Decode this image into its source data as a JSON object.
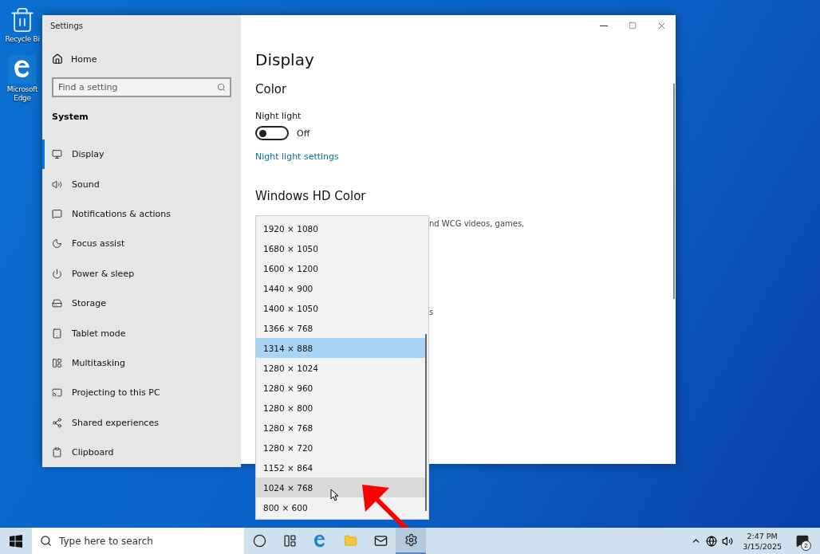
{
  "desktop_icons": [
    {
      "label": "Recycle Bi"
    },
    {
      "label": "Microsoft Edge"
    }
  ],
  "window": {
    "title": "Settings"
  },
  "sidebar": {
    "home": "Home",
    "search": {
      "placeholder": "Find a setting"
    },
    "section": "System",
    "items": [
      {
        "label": "Display",
        "selected": true
      },
      {
        "label": "Sound",
        "selected": false
      },
      {
        "label": "Notifications & actions",
        "selected": false
      },
      {
        "label": "Focus assist",
        "selected": false
      },
      {
        "label": "Power & sleep",
        "selected": false
      },
      {
        "label": "Storage",
        "selected": false
      },
      {
        "label": "Tablet mode",
        "selected": false
      },
      {
        "label": "Multitasking",
        "selected": false
      },
      {
        "label": "Projecting to this PC",
        "selected": false
      },
      {
        "label": "Shared experiences",
        "selected": false
      },
      {
        "label": "Clipboard",
        "selected": false
      }
    ]
  },
  "content": {
    "title": "Display",
    "color_heading": "Color",
    "night_light": {
      "label": "Night light",
      "on": false,
      "state_text": "Off"
    },
    "night_light_link": "Night light settings",
    "hd_heading": "Windows HD Color",
    "hd_text_fragment": "nd WCG videos, games,",
    "fragment_2": "s"
  },
  "resolution_dropdown": {
    "items": [
      {
        "label": "1920 × 1080",
        "selected": false,
        "hovered": false
      },
      {
        "label": "1680 × 1050",
        "selected": false,
        "hovered": false
      },
      {
        "label": "1600 × 1200",
        "selected": false,
        "hovered": false
      },
      {
        "label": "1440 × 900",
        "selected": false,
        "hovered": false
      },
      {
        "label": "1400 × 1050",
        "selected": false,
        "hovered": false
      },
      {
        "label": "1366 × 768",
        "selected": false,
        "hovered": false
      },
      {
        "label": "1314 × 888",
        "selected": true,
        "hovered": false
      },
      {
        "label": "1280 × 1024",
        "selected": false,
        "hovered": false
      },
      {
        "label": "1280 × 960",
        "selected": false,
        "hovered": false
      },
      {
        "label": "1280 × 800",
        "selected": false,
        "hovered": false
      },
      {
        "label": "1280 × 768",
        "selected": false,
        "hovered": false
      },
      {
        "label": "1280 × 720",
        "selected": false,
        "hovered": false
      },
      {
        "label": "1152 × 864",
        "selected": false,
        "hovered": false
      },
      {
        "label": "1024 × 768",
        "selected": false,
        "hovered": true
      },
      {
        "label": "800 × 600",
        "selected": false,
        "hovered": false
      }
    ]
  },
  "taskbar": {
    "search_placeholder": "Type here to search",
    "time": "2:47 PM",
    "date": "3/15/2025",
    "notification_count": "2",
    "apps": [
      {
        "selected": false
      },
      {
        "selected": false
      },
      {
        "selected": false
      },
      {
        "selected": false
      },
      {
        "selected": false
      },
      {
        "selected": true
      }
    ]
  }
}
